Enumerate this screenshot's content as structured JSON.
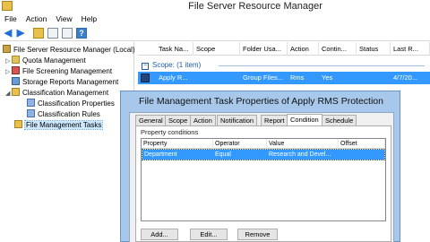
{
  "window": {
    "title": "File Server Resource Manager"
  },
  "menu": [
    "File",
    "Action",
    "View",
    "Help"
  ],
  "toolbar": {
    "icons": [
      "back-arrow-icon",
      "forward-arrow-icon",
      "up-folder-icon",
      "console-tree-icon",
      "properties-icon",
      "help-icon"
    ],
    "help_glyph": "?"
  },
  "tree": {
    "root": "File Server Resource Manager (Local)",
    "items": [
      {
        "label": "Quota Management",
        "expander": "▷"
      },
      {
        "label": "File Screening Management",
        "expander": "▷"
      },
      {
        "label": "Storage Reports Management",
        "expander": ""
      },
      {
        "label": "Classification Management",
        "expander": "◢"
      },
      {
        "label": "Classification Properties",
        "expander": ""
      },
      {
        "label": "Classification Rules",
        "expander": ""
      },
      {
        "label": "File Management Tasks",
        "expander": ""
      }
    ]
  },
  "list": {
    "columns": [
      "Task Na...",
      "Scope",
      "Folder Usa...",
      "Action",
      "Contin...",
      "Status",
      "Last R..."
    ],
    "group": {
      "label": "Scope:  (1 item)",
      "toggle": "−"
    },
    "rows": [
      {
        "task": "Apply R...",
        "scope": "",
        "folder_usage": "Group Files...",
        "action": "Rms",
        "continuous": "Yes",
        "status": "",
        "last_run": "4/7/20..."
      }
    ]
  },
  "dialog": {
    "title": "File Management Task Properties of Apply RMS Protection",
    "tabs": [
      "General",
      "Scope",
      "Action",
      "Notification",
      "Report",
      "Condition",
      "Schedule"
    ],
    "active_tab": "Condition",
    "group_label": "Property conditions",
    "grid_columns": [
      "Property",
      "Operator",
      "Value",
      "Offset"
    ],
    "grid_rows": [
      {
        "property": "Department",
        "operator": "Equal",
        "value": "Research and Devel...",
        "offset": ""
      }
    ],
    "buttons": {
      "add": "Add...",
      "edit": "Edit...",
      "remove": "Remove"
    }
  }
}
